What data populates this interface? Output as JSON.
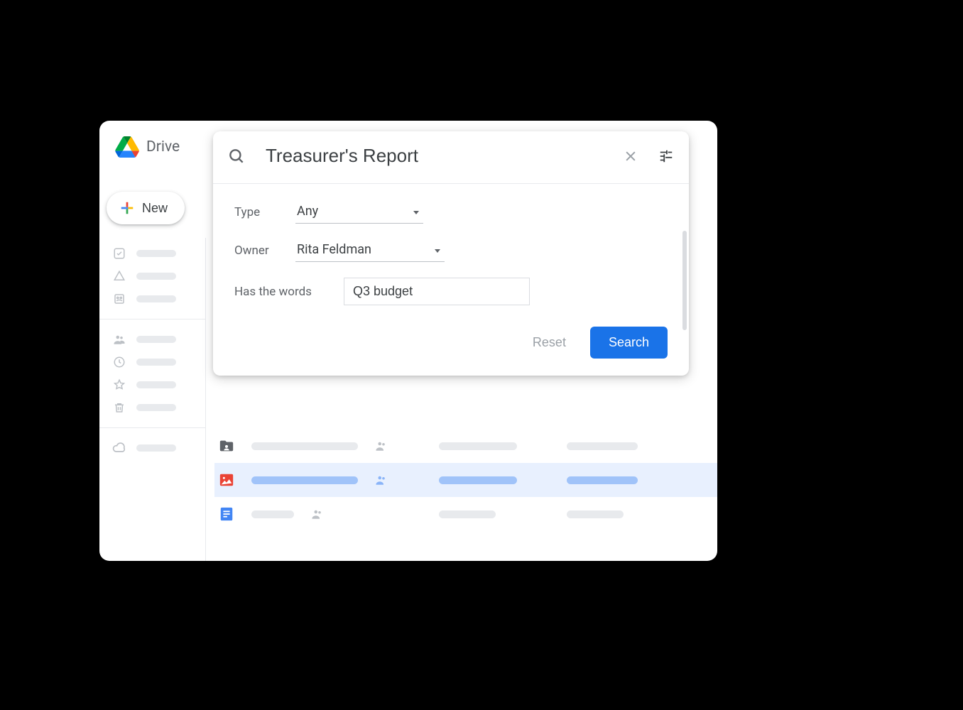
{
  "header": {
    "app_name": "Drive"
  },
  "new_button": {
    "label": "New"
  },
  "sidebar": {
    "icons": [
      "priority",
      "my-drive",
      "shared-drives",
      "shared-with-me",
      "recent",
      "starred",
      "trash",
      "storage"
    ]
  },
  "search": {
    "query": "Treasurer's Report",
    "filters": {
      "type_label": "Type",
      "type_value": "Any",
      "owner_label": "Owner",
      "owner_value": "Rita Feldman",
      "words_label": "Has the words",
      "words_value": "Q3 budget"
    },
    "reset_label": "Reset",
    "search_label": "Search"
  },
  "file_rows": [
    {
      "type": "folder-shared",
      "selected": false
    },
    {
      "type": "image",
      "selected": true
    },
    {
      "type": "doc",
      "selected": false
    }
  ]
}
